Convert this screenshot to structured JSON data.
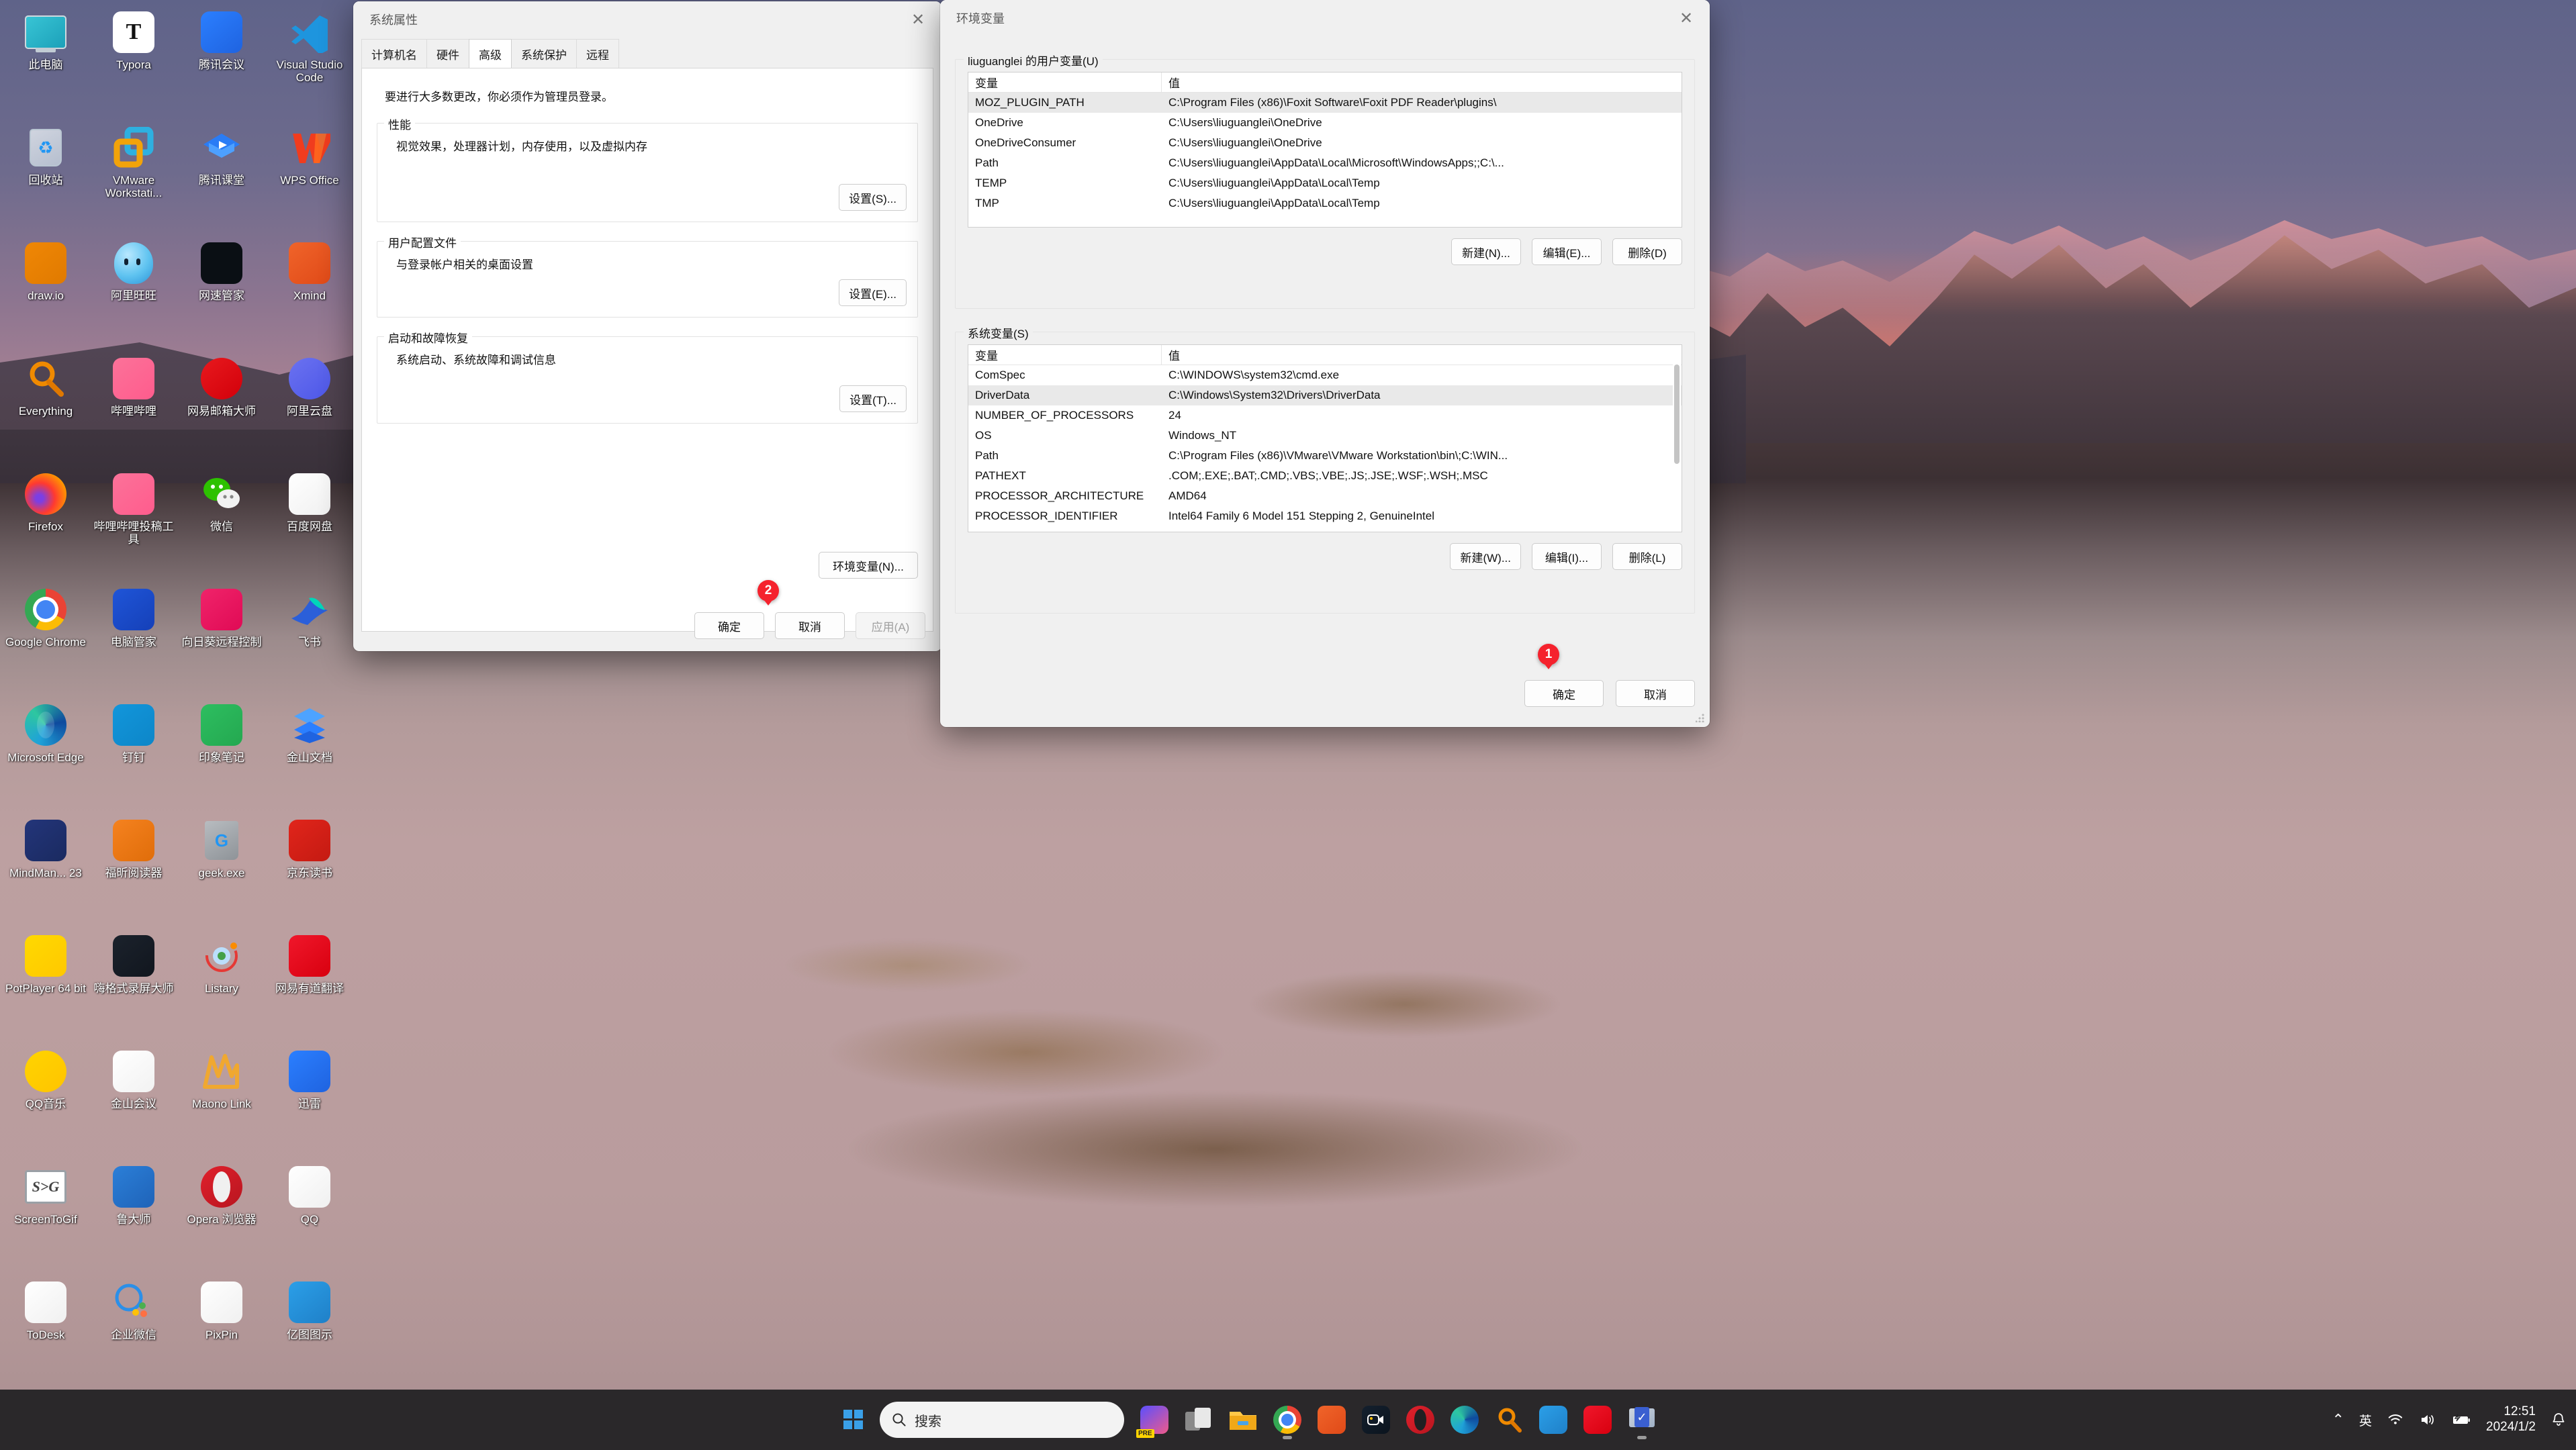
{
  "desktop": {
    "icons": [
      {
        "label": "此电脑",
        "icon": "this-pc-icon",
        "kind": "monitor",
        "c1": "#39c6d6",
        "c2": "#1b9fb8"
      },
      {
        "label": "Typora",
        "icon": "typora-icon",
        "kind": "typora",
        "c1": "#ffffff",
        "c2": "#e8e8e8"
      },
      {
        "label": "腾讯会议",
        "icon": "tencent-meeting-icon",
        "kind": "square",
        "c1": "#2b7fff",
        "c2": "#1f63e0"
      },
      {
        "label": "Visual Studio Code",
        "icon": "vscode-icon",
        "kind": "vscode",
        "c1": "#0f8ad6",
        "c2": "#2b9fe6"
      },
      {
        "label": "回收站",
        "icon": "recycle-bin-icon",
        "kind": "recycle",
        "c1": "#dfe7ee",
        "c2": "#c3d0da"
      },
      {
        "label": "VMware Workstati...",
        "icon": "vmware-icon",
        "kind": "vmware",
        "c1": "#f2a30a",
        "c2": "#2eb0e0"
      },
      {
        "label": "腾讯课堂",
        "icon": "tencent-classroom-icon",
        "kind": "classroom",
        "c1": "#2a7cf5",
        "c2": "#4da0ff"
      },
      {
        "label": "WPS Office",
        "icon": "wps-office-icon",
        "kind": "wps",
        "c1": "#f03c1e",
        "c2": "#ff6a1e"
      },
      {
        "label": "draw.io",
        "icon": "drawio-icon",
        "kind": "square",
        "c1": "#f08705",
        "c2": "#e07a00"
      },
      {
        "label": "阿里旺旺",
        "icon": "aliwangwang-icon",
        "kind": "wangwang",
        "c1": "#5fc3f0",
        "c2": "#2b93d8"
      },
      {
        "label": "网速管家",
        "icon": "netspeed-icon",
        "kind": "square",
        "c1": "#0a0f14",
        "c2": "#0a0f14"
      },
      {
        "label": "Xmind",
        "icon": "xmind-icon",
        "kind": "square",
        "c1": "#f0642a",
        "c2": "#e04a18"
      },
      {
        "label": "Everything",
        "icon": "everything-icon",
        "kind": "everything",
        "c1": "#f08a00",
        "c2": "#e07800"
      },
      {
        "label": "哔哩哔哩",
        "icon": "bilibili-icon",
        "kind": "square",
        "c1": "#fb7299",
        "c2": "#ff5c8d"
      },
      {
        "label": "网易邮箱大师",
        "icon": "netease-mail-icon",
        "kind": "circle",
        "c1": "#e8191e",
        "c2": "#d2000a"
      },
      {
        "label": "阿里云盘",
        "icon": "aliyun-drive-icon",
        "kind": "circle",
        "c1": "#6b72f0",
        "c2": "#4d57e8"
      },
      {
        "label": "Firefox",
        "icon": "firefox-icon",
        "kind": "firefox",
        "c1": "#ff9500",
        "c2": "#ff3a30"
      },
      {
        "label": "哔哩哔哩投稿工具",
        "icon": "bilibili-upload-icon",
        "kind": "square",
        "c1": "#fb7299",
        "c2": "#ff5c8d"
      },
      {
        "label": "微信",
        "icon": "wechat-icon",
        "kind": "wechat",
        "c1": "#2dc100",
        "c2": "#23a000"
      },
      {
        "label": "百度网盘",
        "icon": "baidu-netdisk-icon",
        "kind": "square",
        "c1": "#ffffff",
        "c2": "#f0f0f0"
      },
      {
        "label": "Google Chrome",
        "icon": "chrome-icon",
        "kind": "chrome",
        "c1": "#4285f4",
        "c2": "#34a853"
      },
      {
        "label": "电脑管家",
        "icon": "pc-manager-icon",
        "kind": "square",
        "c1": "#1f55d8",
        "c2": "#1540b8"
      },
      {
        "label": "向日葵远程控制",
        "icon": "sunlogin-icon",
        "kind": "square",
        "c1": "#f0246a",
        "c2": "#e00a55"
      },
      {
        "label": "飞书",
        "icon": "feishu-icon",
        "kind": "feishu",
        "c1": "#00d6b9",
        "c2": "#2b5fd9"
      },
      {
        "label": "Microsoft Edge",
        "icon": "edge-icon",
        "kind": "edge",
        "c1": "#1fa2d8",
        "c2": "#2ec7a0"
      },
      {
        "label": "钉钉",
        "icon": "dingtalk-icon",
        "kind": "square",
        "c1": "#1296db",
        "c2": "#0d86c8"
      },
      {
        "label": "印象笔记",
        "icon": "evernote-icon",
        "kind": "square",
        "c1": "#2dbe60",
        "c2": "#24a850"
      },
      {
        "label": "金山文档",
        "icon": "kingsoft-docs-icon",
        "kind": "kdocs",
        "c1": "#2b7fff",
        "c2": "#1f63e0"
      },
      {
        "label": "MindMan... 23",
        "icon": "mindmanager-icon",
        "kind": "square",
        "c1": "#23357a",
        "c2": "#1a2a60"
      },
      {
        "label": "福昕阅读器",
        "icon": "foxit-reader-icon",
        "kind": "square",
        "c1": "#f5821f",
        "c2": "#e06d0a"
      },
      {
        "label": "geek.exe",
        "icon": "geek-uninstaller-icon",
        "kind": "geek",
        "c1": "#b8bcc0",
        "c2": "#8e9398"
      },
      {
        "label": "京东读书",
        "icon": "jd-read-icon",
        "kind": "square",
        "c1": "#e1251b",
        "c2": "#c41a12"
      },
      {
        "label": "PotPlayer 64 bit",
        "icon": "potplayer-icon",
        "kind": "square",
        "c1": "#ffd900",
        "c2": "#ffc800"
      },
      {
        "label": "嗨格式录屏大师",
        "icon": "higeshi-recorder-icon",
        "kind": "square",
        "c1": "#1b222c",
        "c2": "#11161e"
      },
      {
        "label": "Listary",
        "icon": "listary-icon",
        "kind": "listary",
        "c1": "#2196f3",
        "c2": "#ff5722"
      },
      {
        "label": "网易有道翻译",
        "icon": "youdao-translate-icon",
        "kind": "square",
        "c1": "#f0172b",
        "c2": "#d8000f"
      },
      {
        "label": "QQ音乐",
        "icon": "qq-music-icon",
        "kind": "circle",
        "c1": "#ffd400",
        "c2": "#ffc400"
      },
      {
        "label": "金山会议",
        "icon": "kingsoft-meeting-icon",
        "kind": "square",
        "c1": "#ffffff",
        "c2": "#f2f2f2"
      },
      {
        "label": "Maono Link",
        "icon": "maono-link-icon",
        "kind": "maono",
        "c1": "#f0a830",
        "c2": "#e09520"
      },
      {
        "label": "迅雷",
        "icon": "thunder-icon",
        "kind": "square",
        "c1": "#2b7fff",
        "c2": "#1f63e0"
      },
      {
        "label": "ScreenToGif",
        "icon": "screentogif-icon",
        "kind": "s2g",
        "c1": "#ffffff",
        "c2": "#e8e8e8"
      },
      {
        "label": "鲁大师",
        "icon": "ludashi-icon",
        "kind": "square",
        "c1": "#2b7fd8",
        "c2": "#1f63b8"
      },
      {
        "label": "Opera 浏览器",
        "icon": "opera-icon",
        "kind": "opera",
        "c1": "#e0212c",
        "c2": "#b8151f"
      },
      {
        "label": "QQ",
        "icon": "qq-icon",
        "kind": "square",
        "c1": "#ffffff",
        "c2": "#f0f0f0"
      },
      {
        "label": "ToDesk",
        "icon": "todesk-icon",
        "kind": "square",
        "c1": "#ffffff",
        "c2": "#f0f0f0"
      },
      {
        "label": "企业微信",
        "icon": "wecom-icon",
        "kind": "wecom",
        "c1": "#2b8fe8",
        "c2": "#1f70c8"
      },
      {
        "label": "PixPin",
        "icon": "pixpin-icon",
        "kind": "square",
        "c1": "#ffffff",
        "c2": "#f0f0f0"
      },
      {
        "label": "亿图图示",
        "icon": "edraw-icon",
        "kind": "square",
        "c1": "#2b9fe8",
        "c2": "#1f80c8"
      }
    ]
  },
  "system_properties": {
    "title": "系统属性",
    "close_label": "✕",
    "tabs": [
      {
        "label": "计算机名",
        "active": false
      },
      {
        "label": "硬件",
        "active": false
      },
      {
        "label": "高级",
        "active": true
      },
      {
        "label": "系统保护",
        "active": false
      },
      {
        "label": "远程",
        "active": false
      }
    ],
    "admin_notice": "要进行大多数更改，你必须作为管理员登录。",
    "groups": [
      {
        "title": "性能",
        "desc": "视觉效果，处理器计划，内存使用，以及虚拟内存",
        "button": "设置(S)..."
      },
      {
        "title": "用户配置文件",
        "desc": "与登录帐户相关的桌面设置",
        "button": "设置(E)..."
      },
      {
        "title": "启动和故障恢复",
        "desc": "系统启动、系统故障和调试信息",
        "button": "设置(T)..."
      }
    ],
    "env_button": "环境变量(N)...",
    "footer": {
      "ok": "确定",
      "cancel": "取消",
      "apply": "应用(A)"
    },
    "badge": "2"
  },
  "env_dialog": {
    "title": "环境变量",
    "close_label": "✕",
    "user_section": {
      "title": "liuguanglei 的用户变量(U)",
      "columns": [
        "变量",
        "值"
      ],
      "rows": [
        {
          "name": "MOZ_PLUGIN_PATH",
          "value": "C:\\Program Files (x86)\\Foxit Software\\Foxit PDF Reader\\plugins\\",
          "selected": true
        },
        {
          "name": "OneDrive",
          "value": "C:\\Users\\liuguanglei\\OneDrive",
          "selected": false
        },
        {
          "name": "OneDriveConsumer",
          "value": "C:\\Users\\liuguanglei\\OneDrive",
          "selected": false
        },
        {
          "name": "Path",
          "value": "C:\\Users\\liuguanglei\\AppData\\Local\\Microsoft\\WindowsApps;;C:\\...",
          "selected": false
        },
        {
          "name": "TEMP",
          "value": "C:\\Users\\liuguanglei\\AppData\\Local\\Temp",
          "selected": false
        },
        {
          "name": "TMP",
          "value": "C:\\Users\\liuguanglei\\AppData\\Local\\Temp",
          "selected": false
        }
      ],
      "buttons": {
        "new": "新建(N)...",
        "edit": "编辑(E)...",
        "delete": "删除(D)"
      }
    },
    "system_section": {
      "title": "系统变量(S)",
      "columns": [
        "变量",
        "值"
      ],
      "rows": [
        {
          "name": "ComSpec",
          "value": "C:\\WINDOWS\\system32\\cmd.exe",
          "selected": false
        },
        {
          "name": "DriverData",
          "value": "C:\\Windows\\System32\\Drivers\\DriverData",
          "selected": true
        },
        {
          "name": "NUMBER_OF_PROCESSORS",
          "value": "24",
          "selected": false
        },
        {
          "name": "OS",
          "value": "Windows_NT",
          "selected": false
        },
        {
          "name": "Path",
          "value": "C:\\Program Files (x86)\\VMware\\VMware Workstation\\bin\\;C:\\WIN...",
          "selected": false
        },
        {
          "name": "PATHEXT",
          "value": ".COM;.EXE;.BAT;.CMD;.VBS;.VBE;.JS;.JSE;.WSF;.WSH;.MSC",
          "selected": false
        },
        {
          "name": "PROCESSOR_ARCHITECTURE",
          "value": "AMD64",
          "selected": false
        },
        {
          "name": "PROCESSOR_IDENTIFIER",
          "value": "Intel64 Family 6 Model 151 Stepping 2, GenuineIntel",
          "selected": false
        }
      ],
      "buttons": {
        "new": "新建(W)...",
        "edit": "编辑(I)...",
        "delete": "删除(L)"
      }
    },
    "footer": {
      "ok": "确定",
      "cancel": "取消"
    },
    "badge": "1"
  },
  "taskbar": {
    "start_label": "start-button",
    "search": {
      "placeholder": "搜索",
      "value": "搜索"
    },
    "apps": [
      {
        "name": "copilot-icon",
        "c1": "#5a4fff",
        "c2": "#f05a8a",
        "badge": "PRE"
      },
      {
        "name": "task-view-icon",
        "c1": "#d8d8d8",
        "c2": "#8a8a8a",
        "badge": ""
      },
      {
        "name": "file-explorer-icon",
        "c1": "#ffc848",
        "c2": "#f0a818",
        "badge": ""
      },
      {
        "name": "chrome-icon",
        "c1": "#4285f4",
        "c2": "#34a853",
        "badge": "",
        "running": true
      },
      {
        "name": "xmind-icon",
        "c1": "#f0642a",
        "c2": "#e04a18",
        "badge": ""
      },
      {
        "name": "screen-recorder-icon",
        "c1": "#14202e",
        "c2": "#0b141e",
        "badge": ""
      },
      {
        "name": "opera-icon",
        "c1": "#e0212c",
        "c2": "#b8151f",
        "badge": ""
      },
      {
        "name": "edge-icon",
        "c1": "#1fa2d8",
        "c2": "#2ec7a0",
        "badge": ""
      },
      {
        "name": "everything-icon",
        "c1": "#f08a00",
        "c2": "#e07800",
        "badge": ""
      },
      {
        "name": "edraw-icon",
        "c1": "#2b9fe8",
        "c2": "#1f80c8",
        "badge": ""
      },
      {
        "name": "youdao-translate-icon",
        "c1": "#f0172b",
        "c2": "#d8000f",
        "badge": ""
      },
      {
        "name": "system-properties-icon",
        "c1": "#cfd6e0",
        "c2": "#3a5fd0",
        "badge": "",
        "running": true
      }
    ],
    "tray": {
      "chevron": "⌃",
      "ime": "英",
      "wifi": "wifi-icon",
      "volume": "volume-icon",
      "battery": "battery-icon",
      "time": "12:51",
      "date": "2024/1/2",
      "notification": "bell-icon"
    }
  }
}
